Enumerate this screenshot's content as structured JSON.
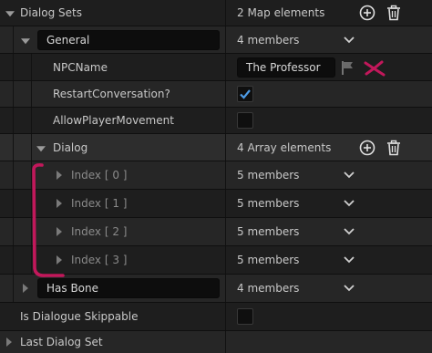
{
  "dialog_sets": {
    "label": "Dialog Sets",
    "value": "2 Map elements"
  },
  "general": {
    "key_value": "General",
    "value": "4 members"
  },
  "npc_name": {
    "label": "NPCName",
    "value": "The Professor"
  },
  "restart_conversation": {
    "label": "RestartConversation?",
    "checked": true
  },
  "allow_player_movement": {
    "label": "AllowPlayerMovement",
    "checked": false
  },
  "dialog": {
    "label": "Dialog",
    "value": "4 Array elements"
  },
  "indexes": [
    {
      "label": "Index [ 0 ]",
      "value": "5 members"
    },
    {
      "label": "Index [ 1 ]",
      "value": "5 members"
    },
    {
      "label": "Index [ 2 ]",
      "value": "5 members"
    },
    {
      "label": "Index [ 3 ]",
      "value": "5 members"
    }
  ],
  "has_bone": {
    "key_value": "Has Bone",
    "value": "4 members"
  },
  "is_dialogue_skippable": {
    "label": "Is Dialogue Skippable",
    "checked": false
  },
  "last_dialog_set": {
    "label": "Last Dialog Set"
  },
  "colors": {
    "annotation": "#c2185b",
    "checkmark": "#4d9be6"
  }
}
